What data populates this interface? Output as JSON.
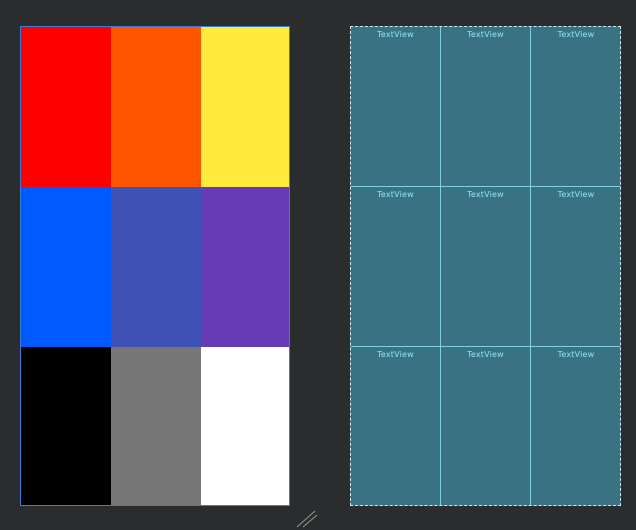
{
  "design_preview": {
    "colors": [
      "#ff0000",
      "#ff5500",
      "#ffeb3b",
      "#005aff",
      "#3f51b5",
      "#673ab7",
      "#000000",
      "#777777",
      "#ffffff"
    ],
    "border_color": "#3b7bd6"
  },
  "blueprint_preview": {
    "cells": [
      {
        "label": "TextView"
      },
      {
        "label": "TextView"
      },
      {
        "label": "TextView"
      },
      {
        "label": "TextView"
      },
      {
        "label": "TextView"
      },
      {
        "label": "TextView"
      },
      {
        "label": "TextView"
      },
      {
        "label": "TextView"
      },
      {
        "label": "TextView"
      }
    ],
    "background_color": "#3a7283",
    "line_color": "#7fd0e4"
  },
  "background_color": "#2b2c2e",
  "resize_handle_icon": "resize-handle-icon"
}
